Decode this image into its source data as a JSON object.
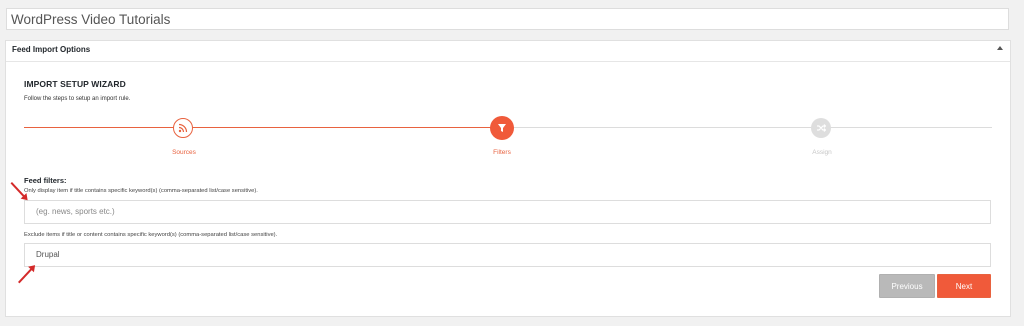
{
  "post_title": "WordPress Video Tutorials",
  "metabox": {
    "title": "Feed Import Options",
    "toggle_icon": "arrow-up-icon"
  },
  "wizard": {
    "heading": "IMPORT SETUP WIZARD",
    "description": "Follow the steps to setup an import rule.",
    "steps": [
      {
        "label": "Sources",
        "icon": "rss-icon",
        "state": "completed"
      },
      {
        "label": "Filters",
        "icon": "filter-icon",
        "state": "active"
      },
      {
        "label": "Assign",
        "icon": "shuffle-icon",
        "state": "inactive"
      }
    ],
    "progress_fraction": 0.5
  },
  "filters": {
    "heading": "Feed filters:",
    "include_label": "Only display item if title contains specific keyword(s) (comma-separated list/case sensitive).",
    "include_placeholder": "(eg. news, sports etc.)",
    "include_value": "",
    "exclude_label": "Exclude items if title or content contains specific keyword(s) (comma-separated list/case sensitive).",
    "exclude_value": "Drupal"
  },
  "buttons": {
    "previous": "Previous",
    "next": "Next"
  },
  "colors": {
    "accent": "#f05a3a",
    "inactive": "#dedede",
    "annotation_arrow": "#d42a2a"
  }
}
